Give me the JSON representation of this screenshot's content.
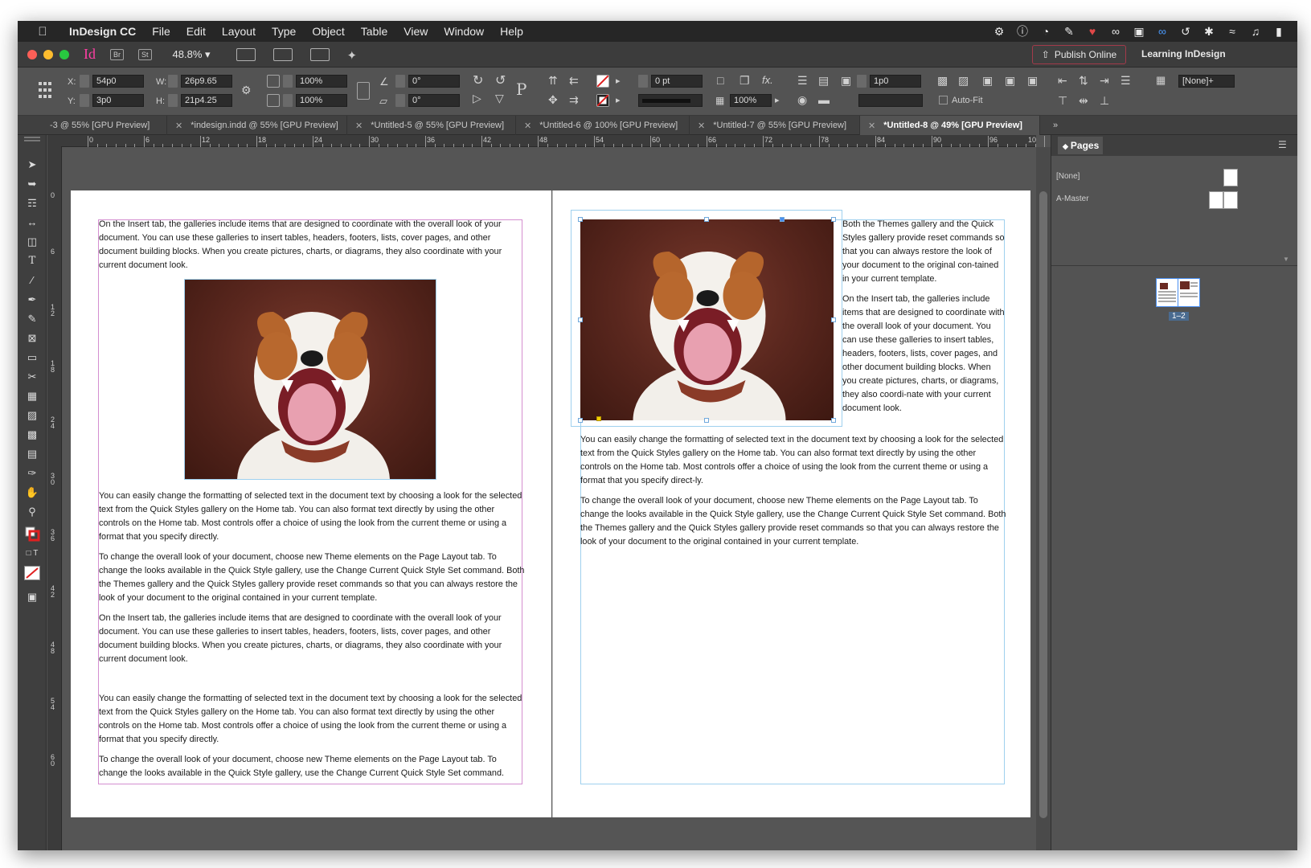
{
  "menubar": {
    "app_name": "InDesign CC",
    "items": [
      "File",
      "Edit",
      "Layout",
      "Type",
      "Object",
      "Table",
      "View",
      "Window",
      "Help"
    ]
  },
  "appbar": {
    "zoom": "48.8%",
    "bridge": "Br",
    "stock": "St",
    "publish_label": "Publish Online",
    "workspace_label": "Learning InDesign"
  },
  "control": {
    "x_label": "X:",
    "x_value": "54p0",
    "y_label": "Y:",
    "y_value": "3p0",
    "w_label": "W:",
    "w_value": "26p9.65",
    "h_label": "H:",
    "h_value": "21p4.25",
    "scale_x": "100%",
    "scale_y": "100%",
    "rotate": "0°",
    "shear": "0°",
    "stroke_weight": "0 pt",
    "opacity": "100%",
    "offset": "1p0",
    "autofit_label": "Auto-Fit",
    "style_value": "[None]+"
  },
  "tabs": [
    {
      "label": "-3 @ 55% [GPU Preview]",
      "active": false
    },
    {
      "label": "*indesign.indd @ 55% [GPU Preview]",
      "active": false
    },
    {
      "label": "*Untitled-5 @ 55% [GPU Preview]",
      "active": false
    },
    {
      "label": "*Untitled-6 @ 100% [GPU Preview]",
      "active": false
    },
    {
      "label": "*Untitled-7 @ 55% [GPU Preview]",
      "active": false
    },
    {
      "label": "*Untitled-8 @ 49% [GPU Preview]",
      "active": true
    }
  ],
  "ruler": {
    "h_labels": [
      "0",
      "6",
      "12",
      "18",
      "24",
      "30",
      "36",
      "42",
      "48",
      "54",
      "60",
      "66",
      "72",
      "78",
      "84",
      "90",
      "96",
      "10"
    ],
    "v_labels": [
      "0",
      "6",
      "1 2",
      "1 8",
      "2 4",
      "3 0",
      "3 6",
      "4 2",
      "4 8",
      "5 4",
      "6 0"
    ]
  },
  "page_left": {
    "paragraphs_top": [
      "On the Insert tab, the galleries include items that are designed to coordinate with the overall look of your document. You can use these galleries to insert tables, headers, footers, lists, cover pages, and other document building blocks. When you create pictures, charts, or diagrams, they also coordinate with your current document look."
    ],
    "paragraphs_bottom": [
      "You can easily change the formatting of selected text in the document text by choosing a look for the selected text from the Quick Styles gallery on the Home tab. You can also format text directly by using the other controls on the Home tab. Most controls offer a choice of using the look from the current theme or using a format that you specify directly.",
      "To change the overall look of your document, choose new Theme elements on the Page Layout tab. To change the looks available in the Quick Style gallery, use the Change Current Quick Style Set command. Both the Themes gallery and the Quick Styles gallery provide reset commands so that you can always restore the look of your document to the original contained in your current template.",
      "On the Insert tab, the galleries include items that are designed to coordinate with the overall look of your document. You can use these galleries to insert tables, headers, footers, lists, cover pages, and other document building blocks. When you create pictures, charts, or diagrams, they also coordinate with your current document look.",
      "You can easily change the formatting of selected text in the document text by choosing a look for the selected text from the Quick Styles gallery on the Home tab. You can also format text directly by using the other controls on the Home tab. Most controls offer a choice of using the look from the current theme or using a format that you specify directly.",
      "To change the overall look of your document, choose new Theme elements on the Page Layout tab. To change the looks available in the Quick Style gallery, use the Change Current Quick Style Set command."
    ]
  },
  "page_right": {
    "wrap_paragraphs": [
      "Both the Themes gallery and the Quick Styles gallery provide reset commands so that you can always restore the look of your document to the original con-tained in your current template.",
      "On the Insert tab, the galleries include items that are designed to coordinate with the overall look of your document. You can use these galleries to insert tables, headers, footers, lists, cover pages, and other document building blocks. When you create pictures, charts, or diagrams, they also coordi-nate with your current document look."
    ],
    "full_paragraphs": [
      "You can easily change the formatting of selected text in the document text by choosing a look for the selected text from the Quick Styles gallery on the Home tab. You can also format text directly by using the other controls on the Home tab. Most controls offer a choice of using the look from the current theme or using a format that you specify direct-ly.",
      "To change the overall look of your document, choose new Theme elements on the Page Layout tab. To change the looks available in the Quick Style gallery, use the Change Current Quick Style Set command. Both the Themes gallery and the Quick Styles gallery provide reset commands so that you can always restore the look of your document to the original contained in your current template."
    ]
  },
  "pages_panel": {
    "title": "Pages",
    "none_label": "[None]",
    "master_label": "A-Master",
    "spread_label": "1–2"
  },
  "colors": {
    "accent_pink": "#ff3fa4",
    "frame_magenta": "#d48ed0",
    "frame_blue": "#9fd0ee"
  }
}
